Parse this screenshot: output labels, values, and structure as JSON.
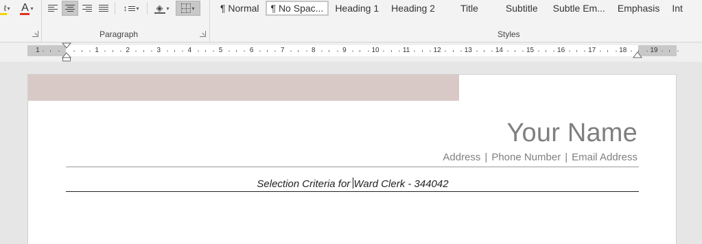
{
  "ribbon": {
    "paragraph_group_label": "Paragraph",
    "styles_group_label": "Styles",
    "styles": [
      {
        "label": "¶ Normal",
        "selected": false
      },
      {
        "label": "¶ No Spac...",
        "selected": true
      },
      {
        "label": "Heading 1",
        "selected": false
      },
      {
        "label": "Heading 2",
        "selected": false
      },
      {
        "label": "Title",
        "selected": false
      },
      {
        "label": "Subtitle",
        "selected": false
      },
      {
        "label": "Subtle Em...",
        "selected": false
      },
      {
        "label": "Emphasis",
        "selected": false
      },
      {
        "label": "Int",
        "selected": false
      }
    ],
    "font_color_glyph": "A",
    "accent_colors": {
      "font_color_bar": "#e03020",
      "highlight_bar": "#f2d10a"
    }
  },
  "ruler": {
    "numbers": [
      "1",
      "1",
      "2",
      "3",
      "4",
      "5",
      "6",
      "7",
      "8",
      "9",
      "10",
      "11",
      "12",
      "13",
      "14",
      "15",
      "16",
      "17",
      "18",
      "19"
    ]
  },
  "document": {
    "name": "Your Name",
    "contact": {
      "address": "Address",
      "separator": "|",
      "phone": "Phone Number",
      "email": "Email Address"
    },
    "criteria_before_cursor": "Selection Criteria for ",
    "criteria_after_cursor": "Ward Clerk - 344042",
    "header_band_color": "#d8c9c7"
  }
}
